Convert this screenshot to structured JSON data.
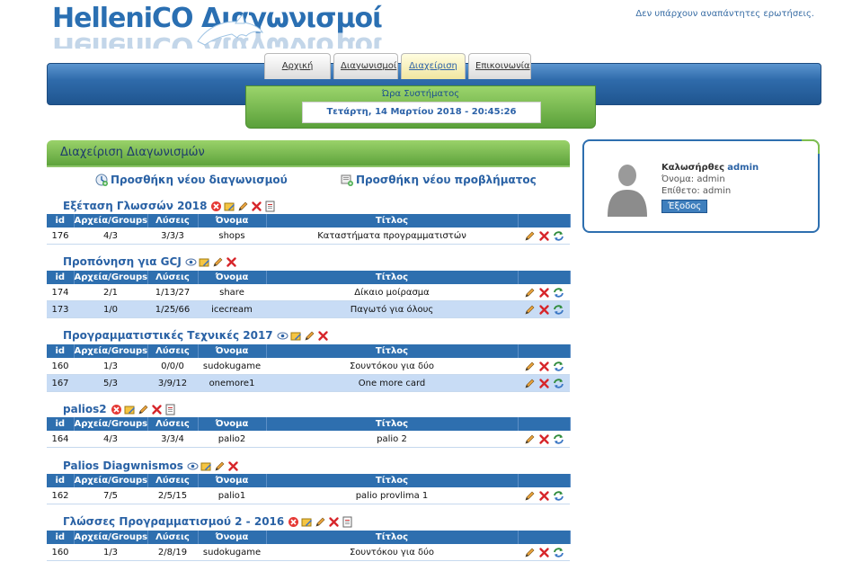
{
  "header": {
    "logo_text": "HelleniCO Διαγωνισμοί",
    "notice": "Δεν υπάρχουν αναπάντητες ερωτήσεις."
  },
  "nav": {
    "tabs": [
      {
        "label": "Αρχική"
      },
      {
        "label": "Διαγωνισμοί"
      },
      {
        "label": "Διαχείριση"
      },
      {
        "label": "Επικοινωνία"
      }
    ],
    "active_tab": "Διαχείριση"
  },
  "clock": {
    "title": "Ώρα Συστήματος",
    "value": "Τετάρτη, 14 Μαρτίου 2018 - 20:45:26"
  },
  "panel": {
    "title": "Διαχείριση Διαγωνισμών",
    "add_contest": "Προσθήκη νέου διαγωνισμού",
    "add_problem": "Προσθήκη νέου προβλήματος"
  },
  "table_headers": {
    "id": "id",
    "files": "Αρχεία/Groups",
    "solutions": "Λύσεις",
    "name": "Όνομα",
    "title": "Τίτλος"
  },
  "contests": [
    {
      "title": "Εξέταση Γλωσσών 2018",
      "icons": [
        "delete-x-icon",
        "folder-edit-icon",
        "pencil-icon",
        "cross-icon",
        "document-icon"
      ],
      "problems": [
        {
          "id": "176",
          "files": "4/3",
          "solutions": "3/3/3",
          "name": "shops",
          "title": "Καταστήματα προγραμματιστών"
        }
      ]
    },
    {
      "title": "Προπόνηση για GCJ",
      "icons": [
        "eye-icon",
        "folder-edit-icon",
        "pencil-icon",
        "cross-icon"
      ],
      "problems": [
        {
          "id": "174",
          "files": "2/1",
          "solutions": "1/13/27",
          "name": "share",
          "title": "Δίκαιο μοίρασμα"
        },
        {
          "id": "173",
          "files": "1/0",
          "solutions": "1/25/66",
          "name": "icecream",
          "title": "Παγωτό για όλους"
        }
      ]
    },
    {
      "title": "Προγραμματιστικές Τεχνικές 2017",
      "icons": [
        "eye-icon",
        "folder-edit-icon",
        "pencil-icon",
        "cross-icon"
      ],
      "problems": [
        {
          "id": "160",
          "files": "1/3",
          "solutions": "0/0/0",
          "name": "sudokugame",
          "title": "Σουντόκου για δύο"
        },
        {
          "id": "167",
          "files": "5/3",
          "solutions": "3/9/12",
          "name": "onemore1",
          "title": "One more card"
        }
      ]
    },
    {
      "title": "palios2",
      "icons": [
        "delete-x-icon",
        "folder-edit-icon",
        "pencil-icon",
        "cross-icon",
        "document-icon"
      ],
      "problems": [
        {
          "id": "164",
          "files": "4/3",
          "solutions": "3/3/4",
          "name": "palio2",
          "title": "palio 2"
        }
      ]
    },
    {
      "title": "Palios Diagwnismos",
      "icons": [
        "eye-icon",
        "folder-edit-icon",
        "pencil-icon",
        "cross-icon"
      ],
      "problems": [
        {
          "id": "162",
          "files": "7/5",
          "solutions": "2/5/15",
          "name": "palio1",
          "title": "palio provlima 1"
        }
      ]
    },
    {
      "title": "Γλώσσες Προγραμματισμού 2 - 2016",
      "icons": [
        "delete-x-icon",
        "folder-edit-icon",
        "pencil-icon",
        "cross-icon",
        "document-icon"
      ],
      "problems": [
        {
          "id": "160",
          "files": "1/3",
          "solutions": "2/8/19",
          "name": "sudokugame",
          "title": "Σουντόκου για δύο"
        }
      ]
    }
  ],
  "user": {
    "welcome": "Καλωσήρθες",
    "username": "admin",
    "name_line": "Όνομα: admin",
    "surname_line": "Επίθετο: admin",
    "logout": "Έξοδος"
  },
  "colors": {
    "primary_blue": "#2e6faf",
    "accent_green": "#6fb548",
    "link_blue": "#2a62a5",
    "alt_row": "#c8dcf5"
  }
}
